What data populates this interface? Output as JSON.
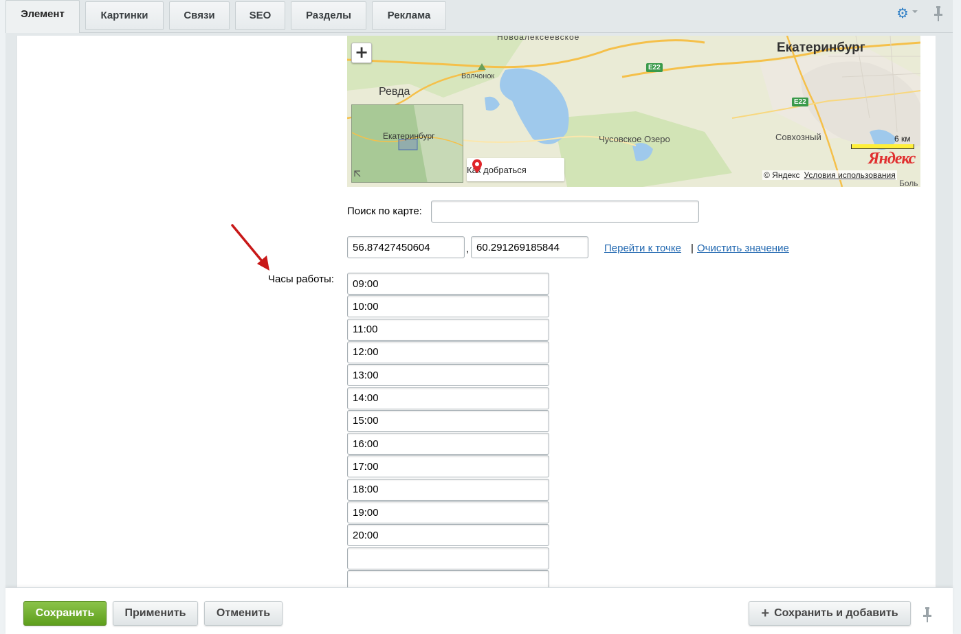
{
  "tabs": [
    {
      "label": "Элемент",
      "active": true
    },
    {
      "label": "Картинки",
      "active": false
    },
    {
      "label": "Связи",
      "active": false
    },
    {
      "label": "SEO",
      "active": false
    },
    {
      "label": "Разделы",
      "active": false
    },
    {
      "label": "Реклама",
      "active": false
    }
  ],
  "header": {
    "settings_icon": "gear-icon",
    "pin_icon": "pin-icon"
  },
  "map": {
    "zoom_in": "+",
    "labels": {
      "ekaterinburg": "Екатеринбург",
      "revda": "Ревда",
      "volchonok": "Волчонок",
      "novoalekseevskoe": "Новоалексеевское",
      "chusovskoe": "Чусовское Озеро",
      "sovkhozny": "Совхозный",
      "road1": "E22",
      "road2": "E22",
      "minimap_city": "Екатеринбург",
      "bol": "Боль"
    },
    "scale_label": "6 км",
    "route_button": "Как добраться",
    "logo": "Яндекс",
    "copyright": "© Яндекс",
    "terms_link": "Условия использования",
    "colors": {
      "water": "#9fc9ec",
      "forest": "#cfe3b2",
      "road_major": "#f5c04a",
      "scale": "#ffef3a"
    }
  },
  "search": {
    "label": "Поиск по карте:",
    "value": ""
  },
  "coords": {
    "lat": "56.87427450604",
    "separator": ",",
    "lng": "60.291269185844",
    "goto_link": "Перейти к точке",
    "divider": "|",
    "clear_link": "Очистить значение"
  },
  "hours": {
    "label": "Часы работы:",
    "values": [
      "09:00",
      "10:00",
      "11:00",
      "12:00",
      "13:00",
      "14:00",
      "15:00",
      "16:00",
      "17:00",
      "18:00",
      "19:00",
      "20:00",
      "",
      ""
    ]
  },
  "footer": {
    "save": "Сохранить",
    "apply": "Применить",
    "cancel": "Отменить",
    "save_add": "Сохранить и добавить",
    "save_add_icon": "+"
  },
  "colors": {
    "link": "#2067b0",
    "save_green": "#6aaa27",
    "arrow_red": "#c81818"
  }
}
